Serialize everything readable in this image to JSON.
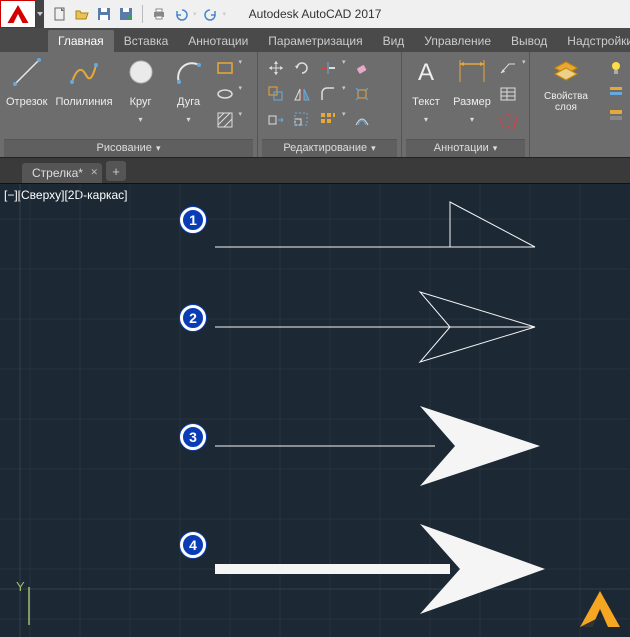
{
  "app": {
    "title": "Autodesk AutoCAD 2017"
  },
  "tabs": {
    "items": [
      {
        "label": "Главная",
        "active": true
      },
      {
        "label": "Вставка"
      },
      {
        "label": "Аннотации"
      },
      {
        "label": "Параметризация"
      },
      {
        "label": "Вид"
      },
      {
        "label": "Управление"
      },
      {
        "label": "Вывод"
      },
      {
        "label": "Надстройки"
      }
    ]
  },
  "panels": {
    "draw": {
      "title": "Рисование",
      "line": "Отрезок",
      "polyline": "Полилиния",
      "circle": "Круг",
      "arc": "Дуга"
    },
    "modify": {
      "title": "Редактирование"
    },
    "annot": {
      "title": "Аннотации",
      "text": "Текст",
      "dim": "Размер"
    },
    "layers": {
      "title": "Свойства слоя"
    }
  },
  "file": {
    "tab": "Стрелка*"
  },
  "viewport": {
    "label": "[−][Сверху][2D-каркас]",
    "markers": [
      "1",
      "2",
      "3",
      "4"
    ],
    "ucs_y": "Y"
  }
}
